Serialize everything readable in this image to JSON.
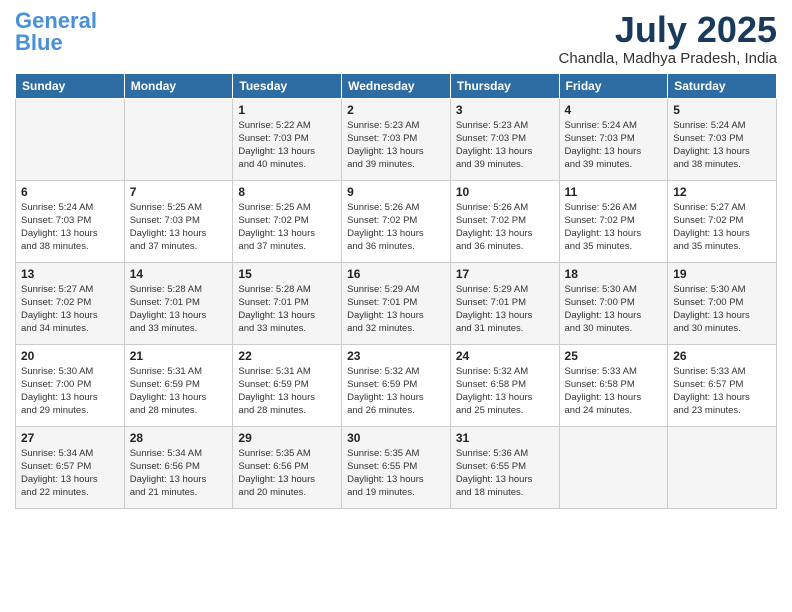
{
  "header": {
    "logo_general": "General",
    "logo_blue": "Blue",
    "month_year": "July 2025",
    "location": "Chandla, Madhya Pradesh, India"
  },
  "days_of_week": [
    "Sunday",
    "Monday",
    "Tuesday",
    "Wednesday",
    "Thursday",
    "Friday",
    "Saturday"
  ],
  "weeks": [
    [
      {
        "day": "",
        "content": ""
      },
      {
        "day": "",
        "content": ""
      },
      {
        "day": "1",
        "content": "Sunrise: 5:22 AM\nSunset: 7:03 PM\nDaylight: 13 hours\nand 40 minutes."
      },
      {
        "day": "2",
        "content": "Sunrise: 5:23 AM\nSunset: 7:03 PM\nDaylight: 13 hours\nand 39 minutes."
      },
      {
        "day": "3",
        "content": "Sunrise: 5:23 AM\nSunset: 7:03 PM\nDaylight: 13 hours\nand 39 minutes."
      },
      {
        "day": "4",
        "content": "Sunrise: 5:24 AM\nSunset: 7:03 PM\nDaylight: 13 hours\nand 39 minutes."
      },
      {
        "day": "5",
        "content": "Sunrise: 5:24 AM\nSunset: 7:03 PM\nDaylight: 13 hours\nand 38 minutes."
      }
    ],
    [
      {
        "day": "6",
        "content": "Sunrise: 5:24 AM\nSunset: 7:03 PM\nDaylight: 13 hours\nand 38 minutes."
      },
      {
        "day": "7",
        "content": "Sunrise: 5:25 AM\nSunset: 7:03 PM\nDaylight: 13 hours\nand 37 minutes."
      },
      {
        "day": "8",
        "content": "Sunrise: 5:25 AM\nSunset: 7:02 PM\nDaylight: 13 hours\nand 37 minutes."
      },
      {
        "day": "9",
        "content": "Sunrise: 5:26 AM\nSunset: 7:02 PM\nDaylight: 13 hours\nand 36 minutes."
      },
      {
        "day": "10",
        "content": "Sunrise: 5:26 AM\nSunset: 7:02 PM\nDaylight: 13 hours\nand 36 minutes."
      },
      {
        "day": "11",
        "content": "Sunrise: 5:26 AM\nSunset: 7:02 PM\nDaylight: 13 hours\nand 35 minutes."
      },
      {
        "day": "12",
        "content": "Sunrise: 5:27 AM\nSunset: 7:02 PM\nDaylight: 13 hours\nand 35 minutes."
      }
    ],
    [
      {
        "day": "13",
        "content": "Sunrise: 5:27 AM\nSunset: 7:02 PM\nDaylight: 13 hours\nand 34 minutes."
      },
      {
        "day": "14",
        "content": "Sunrise: 5:28 AM\nSunset: 7:01 PM\nDaylight: 13 hours\nand 33 minutes."
      },
      {
        "day": "15",
        "content": "Sunrise: 5:28 AM\nSunset: 7:01 PM\nDaylight: 13 hours\nand 33 minutes."
      },
      {
        "day": "16",
        "content": "Sunrise: 5:29 AM\nSunset: 7:01 PM\nDaylight: 13 hours\nand 32 minutes."
      },
      {
        "day": "17",
        "content": "Sunrise: 5:29 AM\nSunset: 7:01 PM\nDaylight: 13 hours\nand 31 minutes."
      },
      {
        "day": "18",
        "content": "Sunrise: 5:30 AM\nSunset: 7:00 PM\nDaylight: 13 hours\nand 30 minutes."
      },
      {
        "day": "19",
        "content": "Sunrise: 5:30 AM\nSunset: 7:00 PM\nDaylight: 13 hours\nand 30 minutes."
      }
    ],
    [
      {
        "day": "20",
        "content": "Sunrise: 5:30 AM\nSunset: 7:00 PM\nDaylight: 13 hours\nand 29 minutes."
      },
      {
        "day": "21",
        "content": "Sunrise: 5:31 AM\nSunset: 6:59 PM\nDaylight: 13 hours\nand 28 minutes."
      },
      {
        "day": "22",
        "content": "Sunrise: 5:31 AM\nSunset: 6:59 PM\nDaylight: 13 hours\nand 28 minutes."
      },
      {
        "day": "23",
        "content": "Sunrise: 5:32 AM\nSunset: 6:59 PM\nDaylight: 13 hours\nand 26 minutes."
      },
      {
        "day": "24",
        "content": "Sunrise: 5:32 AM\nSunset: 6:58 PM\nDaylight: 13 hours\nand 25 minutes."
      },
      {
        "day": "25",
        "content": "Sunrise: 5:33 AM\nSunset: 6:58 PM\nDaylight: 13 hours\nand 24 minutes."
      },
      {
        "day": "26",
        "content": "Sunrise: 5:33 AM\nSunset: 6:57 PM\nDaylight: 13 hours\nand 23 minutes."
      }
    ],
    [
      {
        "day": "27",
        "content": "Sunrise: 5:34 AM\nSunset: 6:57 PM\nDaylight: 13 hours\nand 22 minutes."
      },
      {
        "day": "28",
        "content": "Sunrise: 5:34 AM\nSunset: 6:56 PM\nDaylight: 13 hours\nand 21 minutes."
      },
      {
        "day": "29",
        "content": "Sunrise: 5:35 AM\nSunset: 6:56 PM\nDaylight: 13 hours\nand 20 minutes."
      },
      {
        "day": "30",
        "content": "Sunrise: 5:35 AM\nSunset: 6:55 PM\nDaylight: 13 hours\nand 19 minutes."
      },
      {
        "day": "31",
        "content": "Sunrise: 5:36 AM\nSunset: 6:55 PM\nDaylight: 13 hours\nand 18 minutes."
      },
      {
        "day": "",
        "content": ""
      },
      {
        "day": "",
        "content": ""
      }
    ]
  ]
}
